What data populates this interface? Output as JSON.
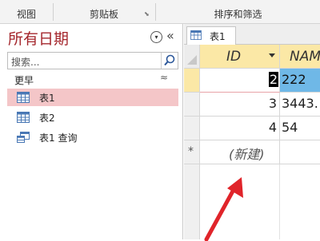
{
  "ribbon": {
    "groups": [
      {
        "label": "视图"
      },
      {
        "label": "剪贴板"
      },
      {
        "label": "排序和筛选"
      }
    ]
  },
  "nav": {
    "title": "所有日期",
    "search_placeholder": "搜索...",
    "group_label": "更早",
    "items": [
      {
        "label": "表1",
        "icon": "table-icon",
        "selected": true
      },
      {
        "label": "表2",
        "icon": "table-icon",
        "selected": false
      },
      {
        "label": "表1 查询",
        "icon": "query-icon",
        "selected": false
      }
    ]
  },
  "document": {
    "tab_label": "表1",
    "columns": [
      {
        "label": "ID"
      },
      {
        "label": "NAM"
      }
    ],
    "rows": [
      {
        "id": "2",
        "name": "222"
      },
      {
        "id": "3",
        "name": "3443."
      },
      {
        "id": "4",
        "name": "54"
      }
    ],
    "new_row_marker": "*",
    "new_row_label": "(新建)"
  },
  "colors": {
    "accent": "#a4262c",
    "selected_nav": "#f4c6c8",
    "header": "#fbe8a6",
    "selected_cell": "#6fb8e7",
    "arrow": "#e0242a"
  }
}
